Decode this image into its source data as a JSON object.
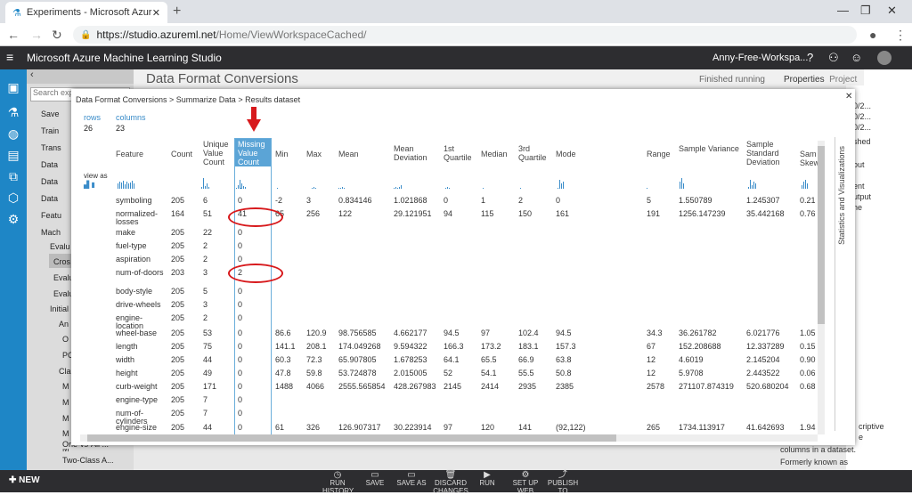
{
  "browser": {
    "tab_title": "Experiments - Microsoft Azure",
    "url_host": "https://studio.azureml.net",
    "url_path": "/Home/ViewWorkspaceCached/"
  },
  "app": {
    "title": "Microsoft Azure Machine Learning Studio",
    "workspace": "Anny-Free-Workspa...",
    "experiment_title": "Data Format Conversions",
    "status": "Finished running",
    "tab_properties": "Properties",
    "tab_project": "Project"
  },
  "palette": {
    "search_placeholder": "Search exp",
    "items": [
      "Save",
      "Train",
      "Trans",
      "Data",
      "Data",
      "Data",
      "Featu",
      "Mach",
      "Evalu",
      "Cros",
      "Evalu",
      "Evalu",
      "Initial",
      "An",
      "O",
      "PC",
      "Cla",
      "M",
      "M",
      "M",
      "M",
      "M",
      "One-vs-All ...",
      "Two-Class A..."
    ]
  },
  "right_pane": {
    "lines": [
      "0/2...",
      "0/2...",
      "0/2...",
      "shed",
      "out",
      "ent",
      "utput",
      "ne",
      "criptive",
      "e",
      "columns in a dataset.",
      "Formerly known as"
    ]
  },
  "modal": {
    "breadcrumb": "Data Format Conversions > Summarize Data > Results dataset",
    "rows_label": "rows",
    "rows_value": "26",
    "columns_label": "columns",
    "columns_value": "23",
    "view_as": "view as",
    "side_title": "Statistics and Visualizations",
    "headers": [
      "Feature",
      "Count",
      "Unique Value Count",
      "Missing Value Count",
      "Min",
      "Max",
      "Mean",
      "Mean Deviation",
      "1st Quartile",
      "Median",
      "3rd Quartile",
      "Mode",
      "Range",
      "Sample Variance",
      "Sample Standard Deviation",
      "Sam Skew"
    ],
    "rows": [
      [
        "symboling",
        "205",
        "6",
        "0",
        "-2",
        "3",
        "0.834146",
        "1.021868",
        "0",
        "1",
        "2",
        "0",
        "5",
        "1.550789",
        "1.245307",
        "0.21"
      ],
      [
        "normalized-losses",
        "164",
        "51",
        "41",
        "65",
        "256",
        "122",
        "29.121951",
        "94",
        "115",
        "150",
        "161",
        "191",
        "1256.147239",
        "35.442168",
        "0.76"
      ],
      [
        "make",
        "205",
        "22",
        "0",
        "",
        "",
        "",
        "",
        "",
        "",
        "",
        "",
        "",
        "",
        "",
        ""
      ],
      [
        "fuel-type",
        "205",
        "2",
        "0",
        "",
        "",
        "",
        "",
        "",
        "",
        "",
        "",
        "",
        "",
        "",
        ""
      ],
      [
        "aspiration",
        "205",
        "2",
        "0",
        "",
        "",
        "",
        "",
        "",
        "",
        "",
        "",
        "",
        "",
        "",
        ""
      ],
      [
        "num-of-doors",
        "203",
        "3",
        "2",
        "",
        "",
        "",
        "",
        "",
        "",
        "",
        "",
        "",
        "",
        "",
        ""
      ],
      [
        "body-style",
        "205",
        "5",
        "0",
        "",
        "",
        "",
        "",
        "",
        "",
        "",
        "",
        "",
        "",
        "",
        ""
      ],
      [
        "drive-wheels",
        "205",
        "3",
        "0",
        "",
        "",
        "",
        "",
        "",
        "",
        "",
        "",
        "",
        "",
        "",
        ""
      ],
      [
        "engine-location",
        "205",
        "2",
        "0",
        "",
        "",
        "",
        "",
        "",
        "",
        "",
        "",
        "",
        "",
        "",
        ""
      ],
      [
        "wheel-base",
        "205",
        "53",
        "0",
        "86.6",
        "120.9",
        "98.756585",
        "4.662177",
        "94.5",
        "97",
        "102.4",
        "94.5",
        "34.3",
        "36.261782",
        "6.021776",
        "1.05"
      ],
      [
        "length",
        "205",
        "75",
        "0",
        "141.1",
        "208.1",
        "174.049268",
        "9.594322",
        "166.3",
        "173.2",
        "183.1",
        "157.3",
        "67",
        "152.208688",
        "12.337289",
        "0.15"
      ],
      [
        "width",
        "205",
        "44",
        "0",
        "60.3",
        "72.3",
        "65.907805",
        "1.678253",
        "64.1",
        "65.5",
        "66.9",
        "63.8",
        "12",
        "4.6019",
        "2.145204",
        "0.90"
      ],
      [
        "height",
        "205",
        "49",
        "0",
        "47.8",
        "59.8",
        "53.724878",
        "2.015005",
        "52",
        "54.1",
        "55.5",
        "50.8",
        "12",
        "5.9708",
        "2.443522",
        "0.06"
      ],
      [
        "curb-weight",
        "205",
        "171",
        "0",
        "1488",
        "4066",
        "2555.565854",
        "428.267983",
        "2145",
        "2414",
        "2935",
        "2385",
        "2578",
        "271107.874319",
        "520.680204",
        "0.68"
      ],
      [
        "engine-type",
        "205",
        "7",
        "0",
        "",
        "",
        "",
        "",
        "",
        "",
        "",
        "",
        "",
        "",
        "",
        ""
      ],
      [
        "num-of-cylinders",
        "205",
        "7",
        "0",
        "",
        "",
        "",
        "",
        "",
        "",
        "",
        "",
        "",
        "",
        "",
        ""
      ],
      [
        "engine-size",
        "205",
        "44",
        "0",
        "61",
        "326",
        "126.907317",
        "30.223914",
        "97",
        "120",
        "141",
        "(92,122)",
        "265",
        "1734.113917",
        "41.642693",
        "1.94"
      ]
    ]
  },
  "bottom": {
    "new_label": "NEW",
    "buttons": [
      "RUN HISTORY",
      "SAVE",
      "SAVE AS",
      "DISCARD CHANGES",
      "RUN",
      "SET UP WEB",
      "PUBLISH TO"
    ]
  },
  "colors": {
    "accent": "#1e86c6",
    "highlight": "#5ba4d6",
    "annotation": "#d7191c"
  }
}
